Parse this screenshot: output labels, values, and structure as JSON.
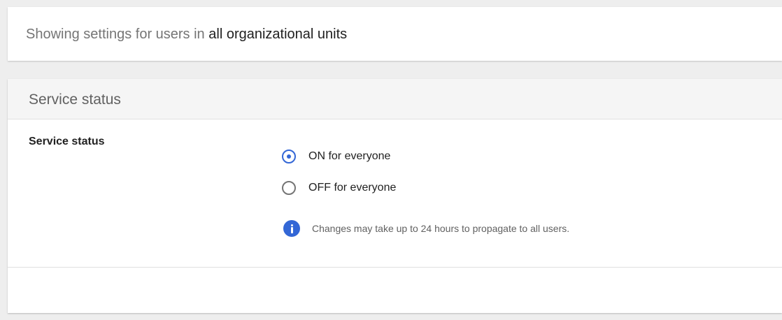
{
  "org_unit_banner": {
    "prefix": "Showing settings for users in",
    "scope": "all organizational units"
  },
  "service_status_panel": {
    "title": "Service status",
    "setting_label": "Service status",
    "options": [
      {
        "label": "ON for everyone",
        "selected": true
      },
      {
        "label": "OFF for everyone",
        "selected": false
      }
    ],
    "info_icon": "info-icon",
    "info_message": "Changes may take up to 24 hours to propagate to all users."
  },
  "colors": {
    "accent": "#3367d6",
    "page_background": "#eeeeee",
    "header_background": "#f5f5f5"
  }
}
